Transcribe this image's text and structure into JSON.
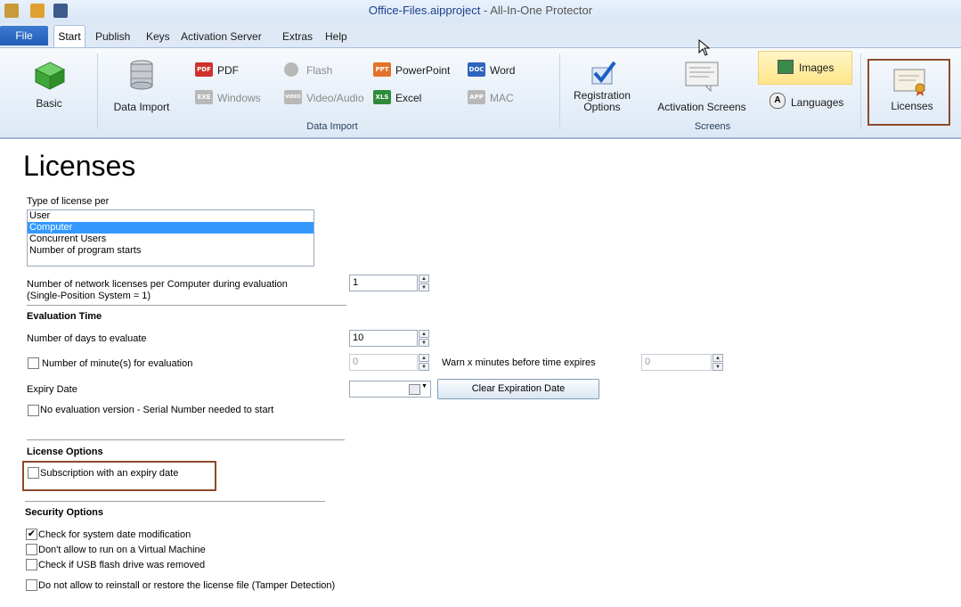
{
  "window": {
    "file_name": "Office-Files.aipproject",
    "separator": " - ",
    "app_name": "All-In-One Protector"
  },
  "menu": {
    "file": "File",
    "start": "Start",
    "publish": "Publish",
    "keys": "Keys",
    "activation_server": "Activation Server",
    "extras": "Extras",
    "help": "Help"
  },
  "ribbon": {
    "basic": "Basic",
    "data_import": "Data Import",
    "pdf": "PDF",
    "windows": "Windows",
    "flash": "Flash",
    "video_audio": "Video/Audio",
    "powerpoint": "PowerPoint",
    "excel": "Excel",
    "word": "Word",
    "mac": "MAC",
    "group_data_import": "Data Import",
    "registration_options_1": "Registration",
    "registration_options_2": "Options",
    "activation_screens": "Activation Screens",
    "images": "Images",
    "languages": "Languages",
    "group_screens": "Screens",
    "licenses": "Licenses",
    "icon_text": {
      "pdf": "PDF",
      "exe": "EXE",
      "video": "VIDEO",
      "ppt": "PPT",
      "xls": "XLS",
      "doc": "DOC",
      "app": "APP",
      "a": "A"
    }
  },
  "page": {
    "title": "Licenses",
    "type_label": "Type of license per",
    "license_types": [
      "User",
      "Computer",
      "Concurrent Users",
      "Number of program starts"
    ],
    "selected_license_type": "Computer",
    "network_licenses_label_1": "Number of network licenses per Computer during evaluation",
    "network_licenses_label_2": "(Single-Position System = 1)",
    "network_licenses_value": "1",
    "evaluation_time_heading": "Evaluation Time",
    "days_label": "Number of days to evaluate",
    "days_value": "10",
    "minutes_label": "Number of minute(s) for evaluation",
    "minutes_value": "0",
    "warn_label": "Warn x minutes before time expires",
    "warn_value": "0",
    "expiry_label": "Expiry Date",
    "expiry_value": "",
    "clear_expiration_button": "Clear Expiration Date",
    "no_eval_label": "No evaluation version - Serial Number needed to start",
    "license_options_heading": "License Options",
    "subscription_label": "Subscription with an expiry date",
    "security_options_heading": "Security Options",
    "security": [
      {
        "label": "Check for system date modification",
        "checked": true
      },
      {
        "label": "Don't allow to run on a Virtual Machine",
        "checked": false
      },
      {
        "label": "Check if USB flash drive was removed",
        "checked": false
      },
      {
        "label": "Do not allow to reinstall or restore the license file (Tamper Detection)",
        "checked": false
      }
    ],
    "check_mark": "✔"
  },
  "colors": {
    "accent": "#3399ff",
    "highlight_border": "#8b4a2a",
    "file_tab": "#1f5db8"
  }
}
